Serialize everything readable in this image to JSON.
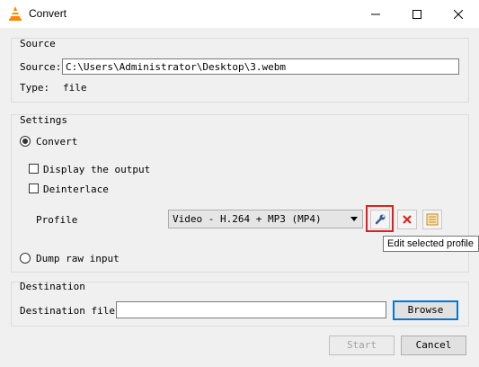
{
  "window": {
    "title": "Convert",
    "controls": [
      "minimize",
      "maximize",
      "close"
    ]
  },
  "source": {
    "group_title": "Source",
    "source_label": "Source:",
    "source_value": "C:\\Users\\Administrator\\Desktop\\3.webm",
    "type_label": "Type:",
    "type_value": "file"
  },
  "settings": {
    "group_title": "Settings",
    "convert_label": "Convert",
    "convert_selected": true,
    "display_output_label": "Display the output",
    "display_output_checked": false,
    "deinterlace_label": "Deinterlace",
    "deinterlace_checked": false,
    "profile_label": "Profile",
    "profile_value": "Video - H.264 + MP3 (MP4)",
    "tooltip": "Edit selected profile",
    "dump_raw_label": "Dump raw input",
    "dump_raw_selected": false
  },
  "destination": {
    "group_title": "Destination",
    "file_label": "Destination file:",
    "file_value": "",
    "browse_label": "Browse"
  },
  "footer": {
    "start_label": "Start",
    "cancel_label": "Cancel"
  },
  "colors": {
    "highlight": "#e21d1d",
    "accent": "#0078d7",
    "delete_red": "#d9251d",
    "vlc_orange": "#ff8800"
  }
}
